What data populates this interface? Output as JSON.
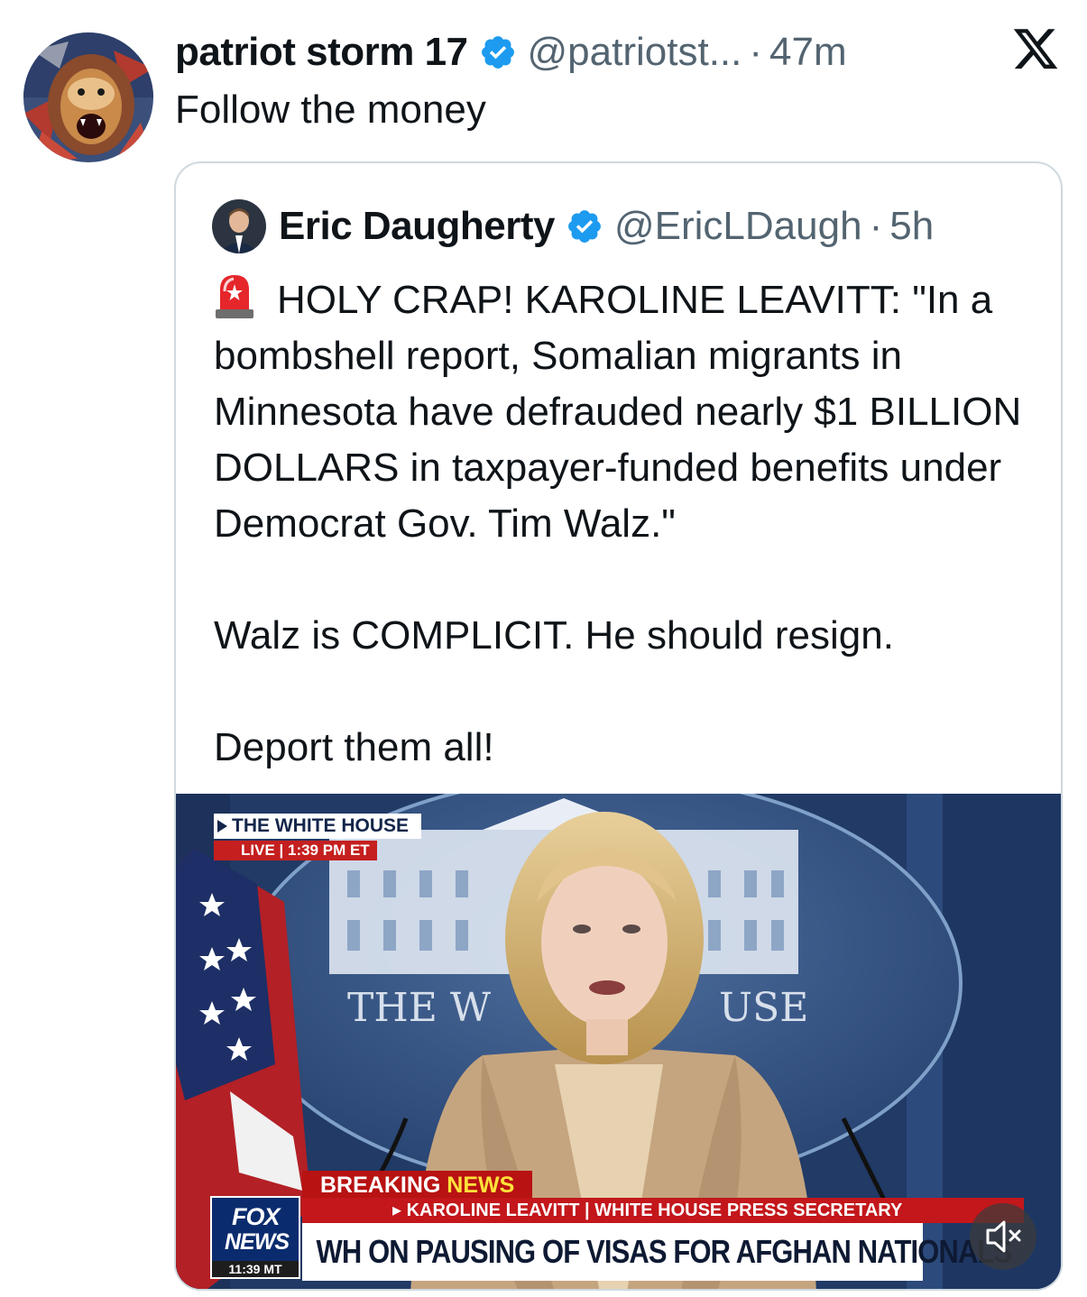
{
  "tweet": {
    "display_name": "patriot storm 17",
    "handle": "@patriotst...",
    "separator": "·",
    "time": "47m",
    "text": "Follow the money"
  },
  "quoted": {
    "display_name": "Eric Daugherty",
    "handle": "@EricLDaugh",
    "separator": "·",
    "time": "5h",
    "lines": [
      "HOLY CRAP! KAROLINE LEAVITT: \"In a bombshell report, Somalian migrants in Minnesota have defrauded nearly $1 BILLION DOLLARS in taxpayer-funded benefits under Democrat Gov. Tim Walz.\"",
      "Walz is COMPLICIT. He should resign.",
      "Deport them all!"
    ]
  },
  "video": {
    "location_label": "THE WHITE HOUSE",
    "live_label": "LIVE | 1:39 PM ET",
    "backdrop_text_left": "THE W",
    "backdrop_text_right": "USE",
    "breaking_label": "BREAKING",
    "news_label": "NEWS",
    "speaker_line": "▸ KAROLINE LEAVITT | WHITE HOUSE PRESS SECRETARY",
    "headline": "WH ON PAUSING OF VISAS FOR AFGHAN NATIONALS",
    "network_line1": "FOX",
    "network_line2": "NEWS",
    "network_time": "11:39 MT"
  },
  "colors": {
    "verified_blue": "#1d9bf0",
    "muted_text": "#536471",
    "fox_red": "#c3171b",
    "fox_navy": "#0a2c6e"
  },
  "icons": {
    "verified": "verified-badge-icon",
    "x_logo": "x-logo-icon",
    "siren": "rotating-light-icon",
    "mute": "speaker-muted-icon"
  }
}
